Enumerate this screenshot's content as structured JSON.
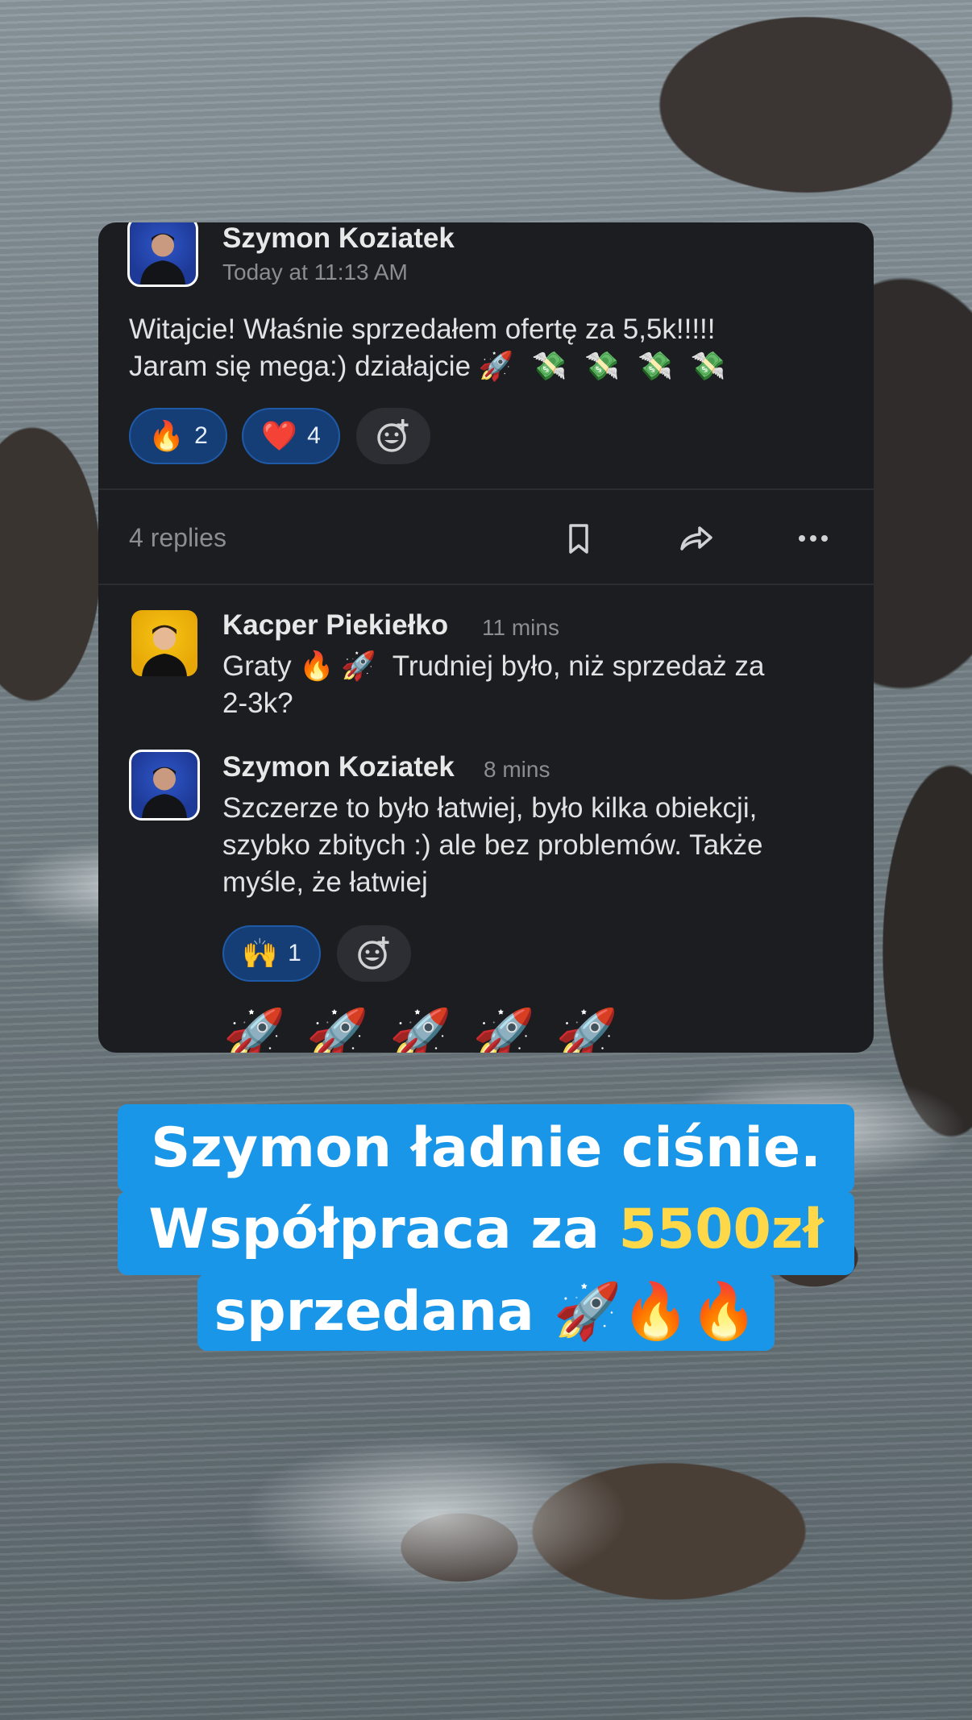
{
  "post": {
    "author": "Szymon Koziatek",
    "timestamp": "Today at 11:13 AM",
    "text_line1": "Witajcie! Właśnie sprzedałem ofertę za 5,5k!!!!!",
    "text_line2": "Jaram się mega:) działajcie",
    "line2_emojis": [
      "🚀",
      "💸",
      "💸",
      "💸",
      "💸"
    ],
    "reactions": [
      {
        "emoji": "🔥",
        "count": "2"
      },
      {
        "emoji": "❤️",
        "count": "4"
      }
    ]
  },
  "thread": {
    "replies_label": "4 replies",
    "actions": [
      "bookmark-icon",
      "share-icon",
      "more-icon"
    ]
  },
  "replies": [
    {
      "author": "Kacper Piekiełko",
      "time": "11 mins",
      "line1_prefix": "Graty",
      "line1_emojis": [
        "🔥",
        "🚀"
      ],
      "line1_suffix": "Trudniej było, niż sprzedaż za",
      "line2": "2-3k?"
    },
    {
      "author": "Szymon Koziatek",
      "time": "8 mins",
      "line1": "Szczerze to było łatwiej, było kilka obiekcji,",
      "line2": "szybko zbitych :) ale bez problemów. Także",
      "line3": "myśle, że łatwiej",
      "reaction": {
        "emoji": "🙌",
        "count": "1"
      },
      "trailing": "🚀🚀🚀🚀🚀"
    }
  ],
  "caption": {
    "line1": "Szymon ładnie ciśnie.",
    "line2_prefix": "Współpraca za ",
    "line2_highlight": "5500zł",
    "line3": "sprzedana 🚀🔥🔥"
  },
  "colors": {
    "card_bg": "#1b1d21",
    "reaction_bg": "#163e76",
    "caption_bg": "#1a96e8",
    "highlight": "#ffd84a"
  }
}
